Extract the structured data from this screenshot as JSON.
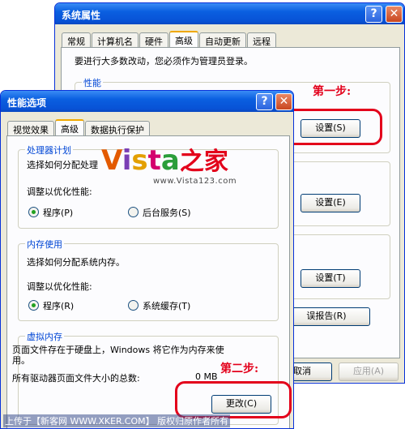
{
  "sys": {
    "title": "系统属性",
    "tabs": [
      "常规",
      "计算机名",
      "硬件",
      "高级",
      "自动更新",
      "远程"
    ],
    "admin_note": "要进行大多数改动，您必须作为管理员登录。",
    "perf_group": "性能",
    "settings_btn1": "设置(S)",
    "settings_btn2": "设置(E)",
    "settings_btn3": "设置(T)",
    "error_report_btn": "误报告(R)",
    "cancel_btn": "取消",
    "apply_btn": "应用(A)"
  },
  "perf": {
    "title": "性能选项",
    "tabs": [
      "视觉效果",
      "高级",
      "数据执行保护"
    ],
    "cpu_group": "处理器计划",
    "cpu_desc": "选择如何分配处理",
    "adjust_label": "调整以优化性能:",
    "radio_programs": "程序(P)",
    "radio_bg": "后台服务(S)",
    "mem_group": "内存使用",
    "mem_desc": "选择如何分配系统内存。",
    "adjust_label2": "调整以优化性能:",
    "radio_programs2": "程序(R)",
    "radio_cache": "系统缓存(T)",
    "vm_group": "虚拟内存",
    "vm_desc1": "页面文件存在于硬盘上，Windows 将它作为内存来使",
    "vm_desc2": "用。",
    "vm_total": "所有驱动器页面文件大小的总数:",
    "vm_total_val": "0 MB",
    "change_btn": "更改(C)"
  },
  "annotations": {
    "step1": "第一步:",
    "step2": "第二步:",
    "watermark_logo": "Vista之家",
    "watermark_url": "www.Vista123.com",
    "footer": "上传于【新客网 WWW.XKER.COM】 版权归原作者所有"
  },
  "colors": {
    "accent_red": "#e3001b",
    "xp_blue": "#0a5fe0",
    "group_label": "#0046d5"
  }
}
